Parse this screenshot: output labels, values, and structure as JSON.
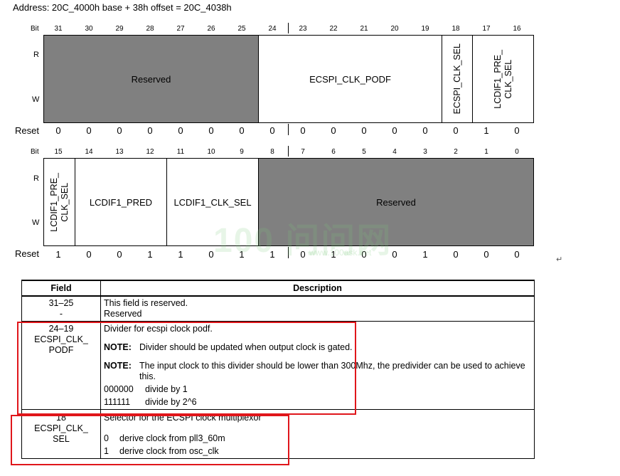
{
  "address": "Address: 20C_4000h base + 38h offset = 20C_4038h",
  "labels": {
    "bit": "Bit",
    "read": "R",
    "write": "W",
    "reset": "Reset"
  },
  "upper": {
    "bits": [
      "31",
      "30",
      "29",
      "28",
      "27",
      "26",
      "25",
      "24",
      "23",
      "22",
      "21",
      "20",
      "19",
      "18",
      "17",
      "16"
    ],
    "reset": [
      "0",
      "0",
      "0",
      "0",
      "0",
      "0",
      "0",
      "0",
      "0",
      "0",
      "0",
      "0",
      "0",
      "0",
      "1",
      "0"
    ],
    "fields": {
      "reserved": "Reserved",
      "podf": "ECSPI_CLK_PODF",
      "ecspi_sel": "ECSPI_CLK_SEL",
      "lcdif_pre_sel": "LCDIF1_PRE_\nCLK_SEL"
    }
  },
  "lower": {
    "bits": [
      "15",
      "14",
      "13",
      "12",
      "11",
      "10",
      "9",
      "8",
      "7",
      "6",
      "5",
      "4",
      "3",
      "2",
      "1",
      "0"
    ],
    "reset": [
      "1",
      "0",
      "0",
      "1",
      "1",
      "0",
      "1",
      "1",
      "0",
      "1",
      "0",
      "0",
      "1",
      "0",
      "0",
      "0"
    ],
    "fields": {
      "lcdif_pre_sel": "LCDIF1_PRE_\nCLK_SEL",
      "pred": "LCDIF1_PRED",
      "clk_sel": "LCDIF1_CLK_SEL",
      "reserved": "Reserved"
    }
  },
  "watermark": {
    "text": "100 问问网",
    "url": "www.100ask.net"
  },
  "table": {
    "headers": {
      "field": "Field",
      "description": "Description"
    },
    "rows": [
      {
        "bits": "31–25",
        "name": "-",
        "lines": [
          "This field is reserved.",
          "Reserved"
        ]
      },
      {
        "bits": "24–19",
        "name": "ECSPI_CLK_\nPODF",
        "intro": "Divider for ecspi clock podf.",
        "notes": [
          {
            "label": "NOTE:",
            "text": "Divider should be updated when output clock is gated."
          },
          {
            "label": "NOTE:",
            "text": "The input clock to this divider should be lower than 300Mhz, the predivider can be used to achieve this."
          }
        ],
        "values": [
          {
            "code": "000000",
            "meaning": "divide by 1"
          },
          {
            "code": "111111",
            "meaning": "divide by 2^6"
          }
        ]
      },
      {
        "bits": "18",
        "name": "ECSPI_CLK_\nSEL",
        "intro": "Selector for the ECSPI clock multiplexor",
        "values": [
          {
            "code": "0",
            "meaning": "derive clock from pll3_60m"
          },
          {
            "code": "1",
            "meaning": "derive clock from osc_clk"
          }
        ]
      }
    ]
  },
  "colors": {
    "reserved_fill": "#808080",
    "highlight": "#e0161b"
  }
}
